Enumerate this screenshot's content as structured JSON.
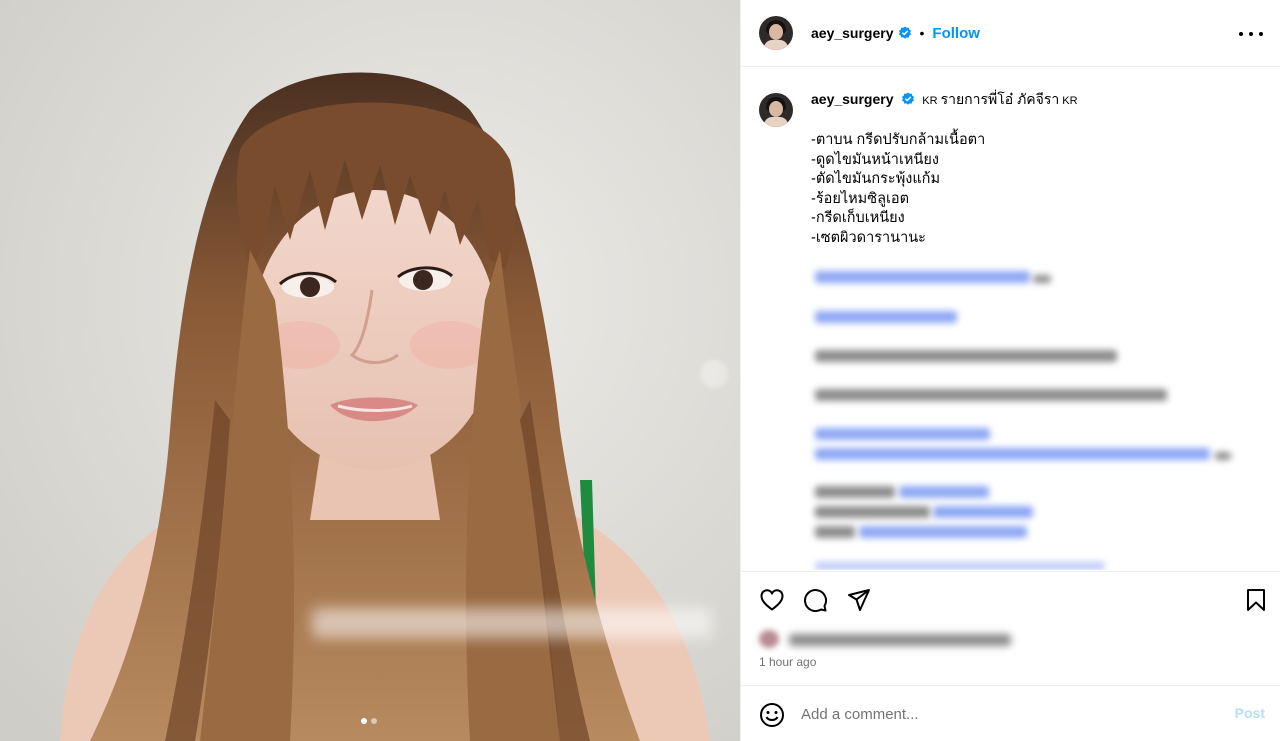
{
  "post": {
    "username": "aey_surgery",
    "follow_label": "Follow",
    "dot": "•",
    "time_ago": "1 hour ago"
  },
  "caption": {
    "username": "aey_surgery",
    "flag_1": "KR",
    "title": "รายการพี่โอ๋ ภัคจีรา",
    "flag_2": "KR",
    "lines": [
      "-ตาบน กรีดปรับกล้ามเนื้อตา",
      "-ดูดไขมันหน้าเหนียง",
      "-ตัดไขมันกระพุ้งแก้ม",
      "-ร้อยไหมซิลูเอต",
      "-กรีดเก็บเหนียง",
      "-เซตผิวดารานานะ"
    ]
  },
  "comment": {
    "placeholder": "Add a comment...",
    "post_label": "Post"
  },
  "media": {
    "slides_total": 2,
    "active_slide": 1
  },
  "colors": {
    "accent": "#0095f6",
    "verified": "#0095f6",
    "post_disabled": "#b2dffc",
    "muted_text": "#737373"
  },
  "icons": [
    "verified-badge-icon",
    "more-options-icon",
    "heart-icon",
    "comment-icon",
    "share-icon",
    "bookmark-icon",
    "emoji-icon",
    "next-slide-icon"
  ]
}
